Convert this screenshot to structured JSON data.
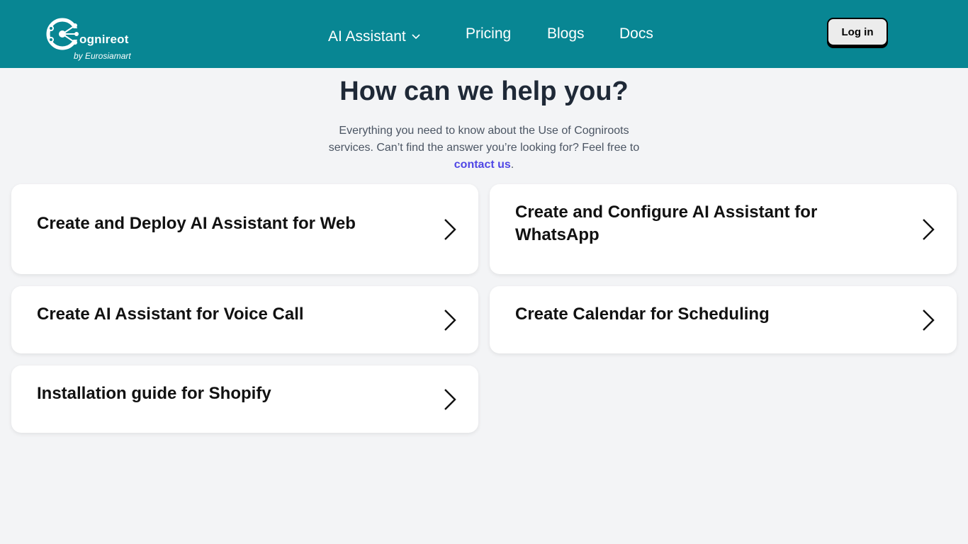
{
  "header": {
    "logo_word": "ognireot",
    "logo_sub": "by Eurosiamart",
    "nav": {
      "ai_assistant": "AI Assistant",
      "pricing": "Pricing",
      "blogs": "Blogs",
      "docs": "Docs"
    },
    "login_label": "Log in"
  },
  "hero": {
    "title": "How can we help you?",
    "subtitle_before": "Everything you need to know about the Use of Cogniroots services. Can’t find the answer you’re looking for? Feel free to ",
    "contact_link": "contact us",
    "subtitle_after": "."
  },
  "cards": [
    {
      "title": "Create and Deploy AI Assistant for Web"
    },
    {
      "title": "Create and Configure AI Assistant for WhatsApp"
    },
    {
      "title": "Create AI Assistant for Voice Call"
    },
    {
      "title": "Create Calendar for Scheduling"
    },
    {
      "title": "Installation guide for Shopify"
    }
  ],
  "colors": {
    "header_bg": "#088693",
    "page_bg": "#f3f4f6",
    "link": "#4f46e5"
  }
}
